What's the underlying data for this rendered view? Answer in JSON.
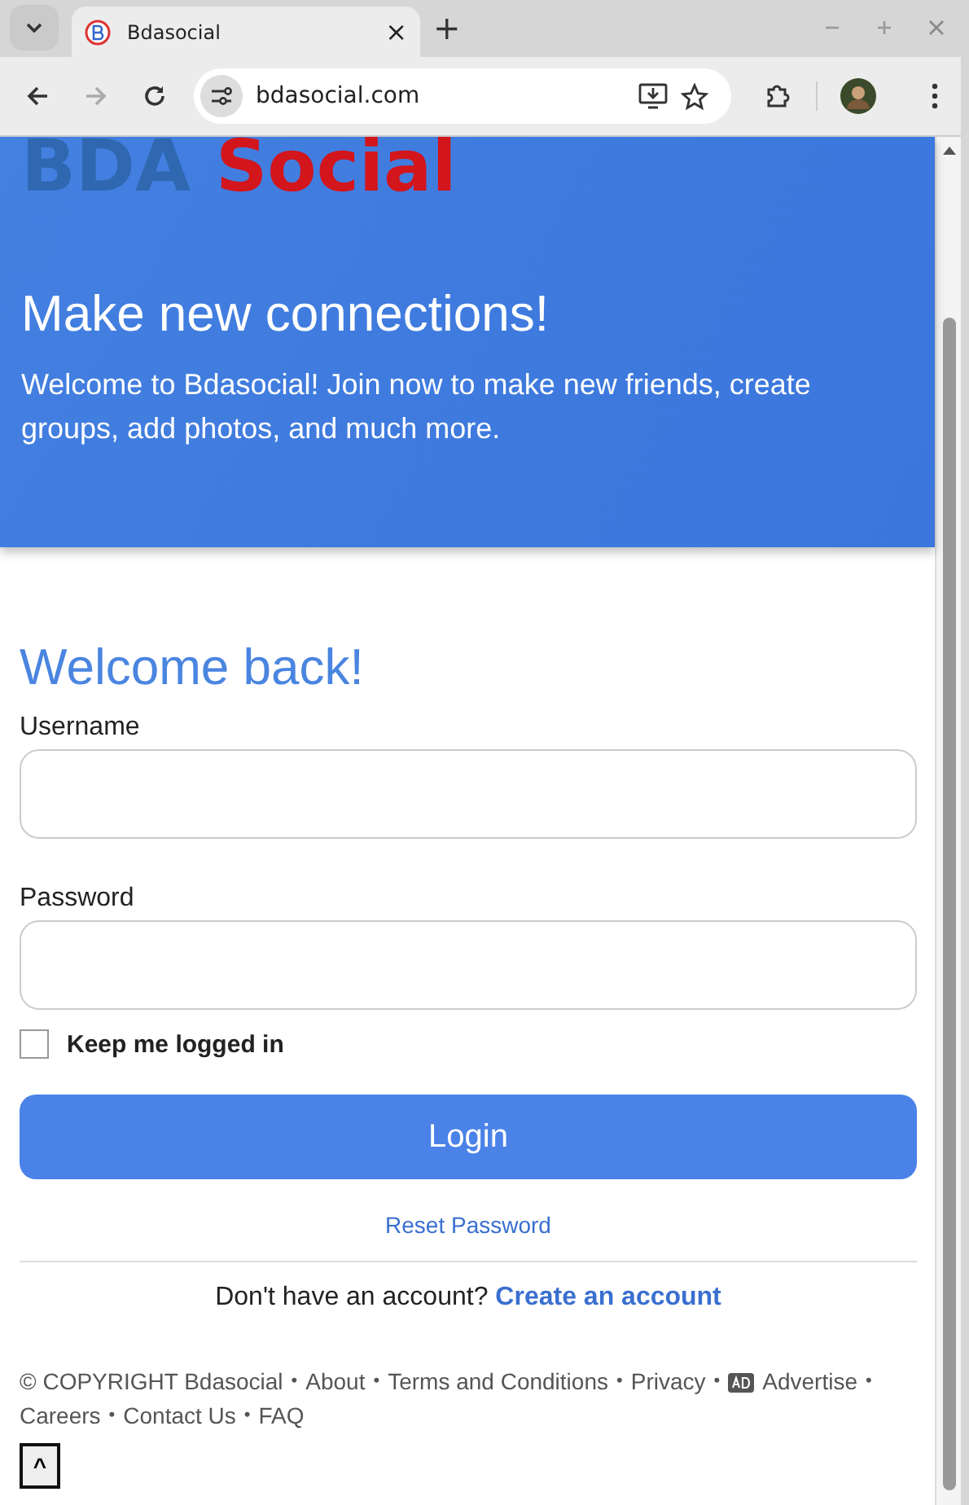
{
  "browser": {
    "tab": {
      "title": "Bdasocial",
      "close": "×",
      "selected": true
    },
    "new_tab": "+",
    "url": "bdasocial.com"
  },
  "logo": {
    "part_1": "BDA",
    "part_2": "Social"
  },
  "hero": {
    "title": "Make new connections!",
    "text": "Welcome to Bdasocial! Join now to make new friends, create groups, add photos, and much more."
  },
  "login": {
    "title": "Welcome back!",
    "fields": [
      {
        "label": "Username"
      },
      {
        "label": "Password"
      }
    ],
    "remember": {
      "label": "Keep me logged in",
      "checked": false
    },
    "button": "Login",
    "reset": "Reset Password",
    "signup_prompt": "Don't have an account?",
    "signup_link": "Create an account"
  },
  "footer": [
    {
      "text": "© COPYRIGHT Bdasocial",
      "kind": "text",
      "bullet": "•"
    },
    {
      "text": "About",
      "kind": "link",
      "bullet": "•"
    },
    {
      "text": "Terms and Conditions",
      "kind": "link",
      "bullet": "•"
    },
    {
      "text": "Privacy",
      "kind": "link",
      "bullet": "•"
    },
    {
      "text": "Advertise",
      "kind": "ad",
      "bullet": "•"
    },
    {
      "text": "Careers",
      "kind": "link",
      "bullet": "•"
    },
    {
      "text": "Contact Us",
      "kind": "link",
      "bullet": "•"
    },
    {
      "text": "FAQ",
      "kind": "link"
    }
  ],
  "back_to_top": "^"
}
